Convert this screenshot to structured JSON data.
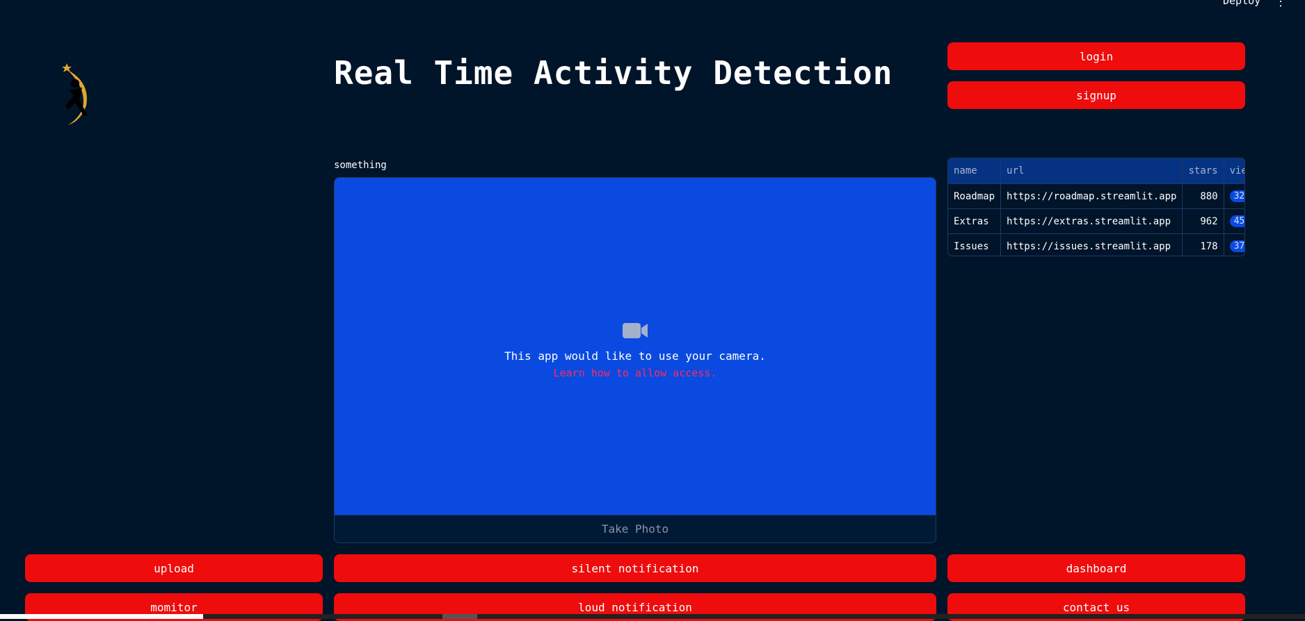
{
  "header": {
    "deploy_label": "Deploy",
    "menu_icon": "kebab-menu-icon",
    "title": "Real Time Activity Detection"
  },
  "auth": {
    "login_label": "login",
    "signup_label": "signup"
  },
  "camera": {
    "label": "something",
    "icon": "video-camera-icon",
    "message": "This app would like to use your camera.",
    "link_text": "Learn how to allow access.",
    "take_photo_label": "Take Photo"
  },
  "table": {
    "columns": [
      "name",
      "url",
      "stars",
      "vie"
    ],
    "rows": [
      {
        "name": "Roadmap",
        "url": "https://roadmap.streamlit.app",
        "stars": "880",
        "views": "32"
      },
      {
        "name": "Extras",
        "url": "https://extras.streamlit.app",
        "stars": "962",
        "views": "45"
      },
      {
        "name": "Issues",
        "url": "https://issues.streamlit.app",
        "stars": "178",
        "views": "37"
      }
    ]
  },
  "actions": {
    "upload": "upload",
    "monitor": "momitor",
    "silent": "silent notification",
    "loud": "loud notification",
    "dashboard": "dashboard",
    "contact": "contact us"
  },
  "colors": {
    "background": "#00142a",
    "button": "#ee0c0c",
    "camera_area": "#0a4ae0",
    "table_header": "#063283",
    "link": "#ff2b5e"
  }
}
